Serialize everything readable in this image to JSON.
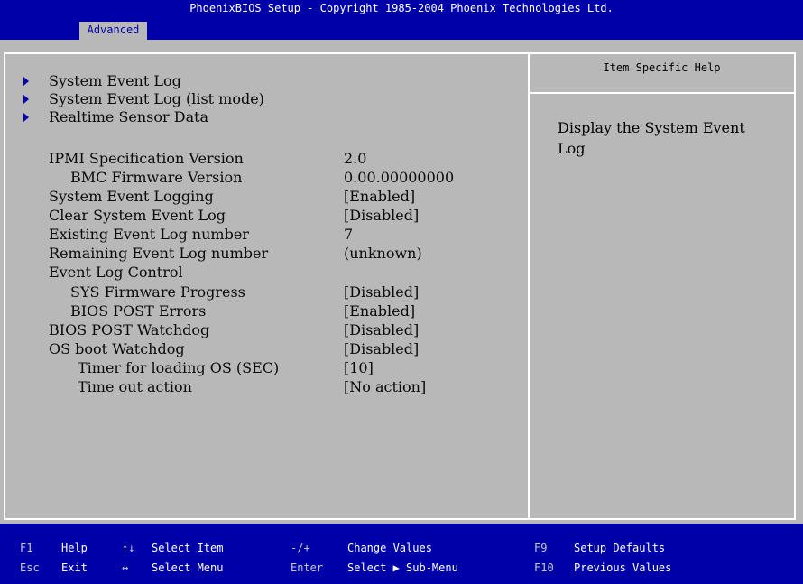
{
  "title": "PhoenixBIOS Setup - Copyright 1985-2004 Phoenix Technologies Ltd.",
  "active_tab": "Advanced",
  "help": {
    "header": "Item Specific Help",
    "text": "Display the System Event Log"
  },
  "menu": {
    "submenus": [
      {
        "label": "System Event Log"
      },
      {
        "label": "System Event Log (list mode)"
      },
      {
        "label": "Realtime Sensor Data"
      }
    ],
    "settings": [
      {
        "label": "IPMI Specification Version",
        "value": "2.0"
      },
      {
        "label": "BMC Firmware Version",
        "value": "0.00.00000000"
      },
      {
        "label": "System Event Logging",
        "value": "[Enabled]"
      },
      {
        "label": "Clear System Event Log",
        "value": "[Disabled]"
      },
      {
        "label": "Existing Event Log number",
        "value": "7"
      },
      {
        "label": "Remaining Event Log number",
        "value": "(unknown)"
      },
      {
        "label": "Event Log Control",
        "value": ""
      },
      {
        "label": "SYS Firmware Progress",
        "value": "[Disabled]"
      },
      {
        "label": "BIOS POST Errors",
        "value": "[Enabled]"
      },
      {
        "label": "BIOS POST Watchdog",
        "value": "[Disabled]"
      },
      {
        "label": "OS boot Watchdog",
        "value": "[Disabled]"
      },
      {
        "label": "Timer for loading OS (SEC)",
        "value": "[10]"
      },
      {
        "label": "Time out action",
        "value": "[No action]"
      }
    ]
  },
  "footer": {
    "keys": [
      {
        "key": "F1",
        "desc": "Help"
      },
      {
        "key": "Esc",
        "desc": "Exit"
      },
      {
        "key": "↑↓",
        "desc": "Select Item"
      },
      {
        "key": "↔",
        "desc": "Select Menu"
      },
      {
        "key": "-/+",
        "desc": "Change Values"
      },
      {
        "key": "Enter",
        "desc": "Select ▶ Sub-Menu"
      },
      {
        "key": "F9",
        "desc": "Setup Defaults"
      },
      {
        "key": "F10",
        "desc": "Previous Values"
      }
    ]
  },
  "colors": {
    "background": "#b8b8b8",
    "bar": "#0000a8",
    "text": "#0a0a0a",
    "frame": "#ffffff"
  }
}
